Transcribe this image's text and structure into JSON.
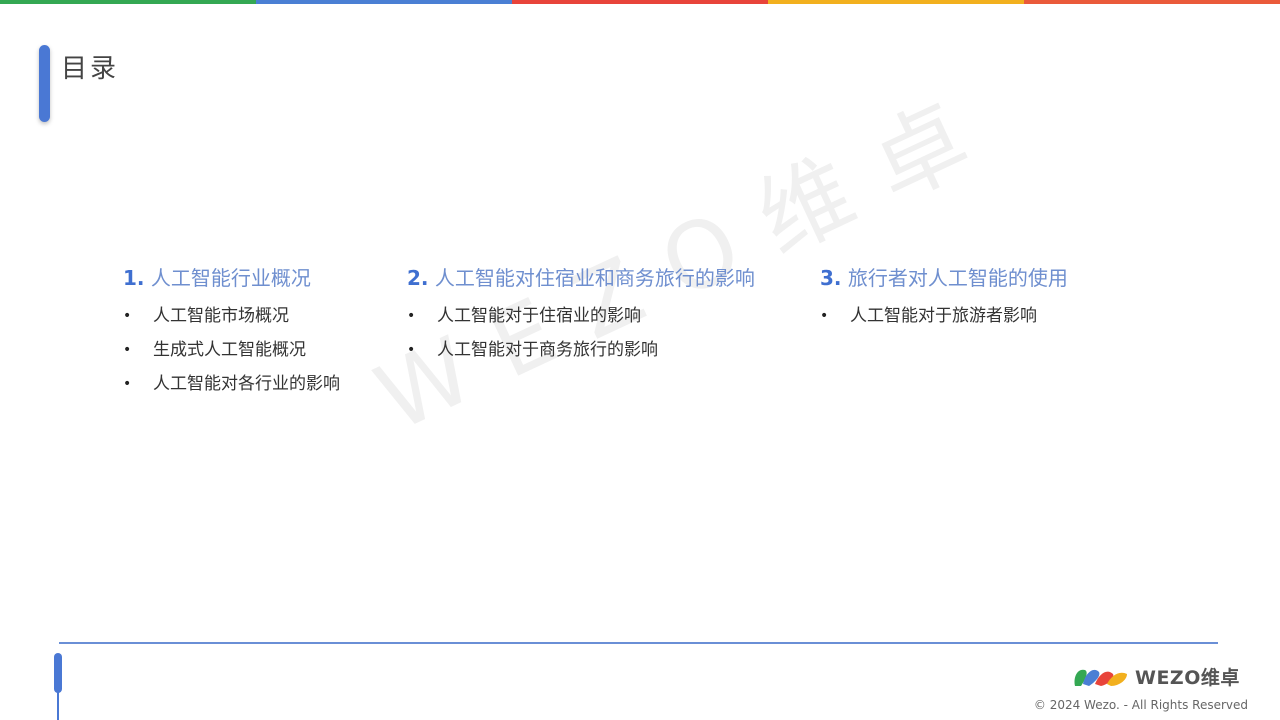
{
  "colors": {
    "bar": [
      "#34a853",
      "#4a7fd4",
      "#e8443a",
      "#f2b01e",
      "#ea5a3a"
    ],
    "accent": "#4a78d4",
    "heading": "#6f8fcf"
  },
  "page_title": "目录",
  "watermark": "WEZO维卓",
  "sections": [
    {
      "num": "1.",
      "title": "人工智能行业概况",
      "items": [
        "人工智能市场概况",
        "生成式人工智能概况",
        "人工智能对各行业的影响"
      ]
    },
    {
      "num": "2.",
      "title": "人工智能对住宿业和商务旅行的影响",
      "items": [
        "人工智能对于住宿业的影响",
        "人工智能对于商务旅行的影响"
      ]
    },
    {
      "num": "3.",
      "title": "旅行者对人工智能的使用",
      "items": [
        "人工智能对于旅游者影响"
      ]
    }
  ],
  "bullet": "•",
  "footer": {
    "logo_text": "WEZO维卓",
    "copyright": "© 2024 Wezo. - All Rights Reserved"
  }
}
